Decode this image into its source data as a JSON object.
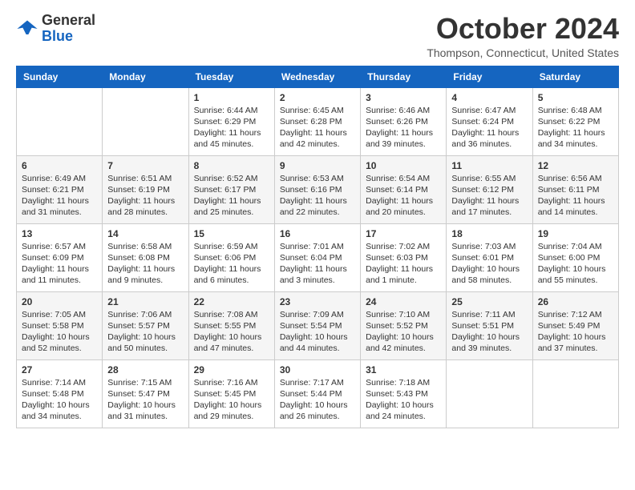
{
  "header": {
    "logo_general": "General",
    "logo_blue": "Blue",
    "month_title": "October 2024",
    "location": "Thompson, Connecticut, United States"
  },
  "calendar": {
    "days_of_week": [
      "Sunday",
      "Monday",
      "Tuesday",
      "Wednesday",
      "Thursday",
      "Friday",
      "Saturday"
    ],
    "weeks": [
      [
        {
          "day": "",
          "detail": ""
        },
        {
          "day": "",
          "detail": ""
        },
        {
          "day": "1",
          "detail": "Sunrise: 6:44 AM\nSunset: 6:29 PM\nDaylight: 11 hours and 45 minutes."
        },
        {
          "day": "2",
          "detail": "Sunrise: 6:45 AM\nSunset: 6:28 PM\nDaylight: 11 hours and 42 minutes."
        },
        {
          "day": "3",
          "detail": "Sunrise: 6:46 AM\nSunset: 6:26 PM\nDaylight: 11 hours and 39 minutes."
        },
        {
          "day": "4",
          "detail": "Sunrise: 6:47 AM\nSunset: 6:24 PM\nDaylight: 11 hours and 36 minutes."
        },
        {
          "day": "5",
          "detail": "Sunrise: 6:48 AM\nSunset: 6:22 PM\nDaylight: 11 hours and 34 minutes."
        }
      ],
      [
        {
          "day": "6",
          "detail": "Sunrise: 6:49 AM\nSunset: 6:21 PM\nDaylight: 11 hours and 31 minutes."
        },
        {
          "day": "7",
          "detail": "Sunrise: 6:51 AM\nSunset: 6:19 PM\nDaylight: 11 hours and 28 minutes."
        },
        {
          "day": "8",
          "detail": "Sunrise: 6:52 AM\nSunset: 6:17 PM\nDaylight: 11 hours and 25 minutes."
        },
        {
          "day": "9",
          "detail": "Sunrise: 6:53 AM\nSunset: 6:16 PM\nDaylight: 11 hours and 22 minutes."
        },
        {
          "day": "10",
          "detail": "Sunrise: 6:54 AM\nSunset: 6:14 PM\nDaylight: 11 hours and 20 minutes."
        },
        {
          "day": "11",
          "detail": "Sunrise: 6:55 AM\nSunset: 6:12 PM\nDaylight: 11 hours and 17 minutes."
        },
        {
          "day": "12",
          "detail": "Sunrise: 6:56 AM\nSunset: 6:11 PM\nDaylight: 11 hours and 14 minutes."
        }
      ],
      [
        {
          "day": "13",
          "detail": "Sunrise: 6:57 AM\nSunset: 6:09 PM\nDaylight: 11 hours and 11 minutes."
        },
        {
          "day": "14",
          "detail": "Sunrise: 6:58 AM\nSunset: 6:08 PM\nDaylight: 11 hours and 9 minutes."
        },
        {
          "day": "15",
          "detail": "Sunrise: 6:59 AM\nSunset: 6:06 PM\nDaylight: 11 hours and 6 minutes."
        },
        {
          "day": "16",
          "detail": "Sunrise: 7:01 AM\nSunset: 6:04 PM\nDaylight: 11 hours and 3 minutes."
        },
        {
          "day": "17",
          "detail": "Sunrise: 7:02 AM\nSunset: 6:03 PM\nDaylight: 11 hours and 1 minute."
        },
        {
          "day": "18",
          "detail": "Sunrise: 7:03 AM\nSunset: 6:01 PM\nDaylight: 10 hours and 58 minutes."
        },
        {
          "day": "19",
          "detail": "Sunrise: 7:04 AM\nSunset: 6:00 PM\nDaylight: 10 hours and 55 minutes."
        }
      ],
      [
        {
          "day": "20",
          "detail": "Sunrise: 7:05 AM\nSunset: 5:58 PM\nDaylight: 10 hours and 52 minutes."
        },
        {
          "day": "21",
          "detail": "Sunrise: 7:06 AM\nSunset: 5:57 PM\nDaylight: 10 hours and 50 minutes."
        },
        {
          "day": "22",
          "detail": "Sunrise: 7:08 AM\nSunset: 5:55 PM\nDaylight: 10 hours and 47 minutes."
        },
        {
          "day": "23",
          "detail": "Sunrise: 7:09 AM\nSunset: 5:54 PM\nDaylight: 10 hours and 44 minutes."
        },
        {
          "day": "24",
          "detail": "Sunrise: 7:10 AM\nSunset: 5:52 PM\nDaylight: 10 hours and 42 minutes."
        },
        {
          "day": "25",
          "detail": "Sunrise: 7:11 AM\nSunset: 5:51 PM\nDaylight: 10 hours and 39 minutes."
        },
        {
          "day": "26",
          "detail": "Sunrise: 7:12 AM\nSunset: 5:49 PM\nDaylight: 10 hours and 37 minutes."
        }
      ],
      [
        {
          "day": "27",
          "detail": "Sunrise: 7:14 AM\nSunset: 5:48 PM\nDaylight: 10 hours and 34 minutes."
        },
        {
          "day": "28",
          "detail": "Sunrise: 7:15 AM\nSunset: 5:47 PM\nDaylight: 10 hours and 31 minutes."
        },
        {
          "day": "29",
          "detail": "Sunrise: 7:16 AM\nSunset: 5:45 PM\nDaylight: 10 hours and 29 minutes."
        },
        {
          "day": "30",
          "detail": "Sunrise: 7:17 AM\nSunset: 5:44 PM\nDaylight: 10 hours and 26 minutes."
        },
        {
          "day": "31",
          "detail": "Sunrise: 7:18 AM\nSunset: 5:43 PM\nDaylight: 10 hours and 24 minutes."
        },
        {
          "day": "",
          "detail": ""
        },
        {
          "day": "",
          "detail": ""
        }
      ]
    ]
  }
}
